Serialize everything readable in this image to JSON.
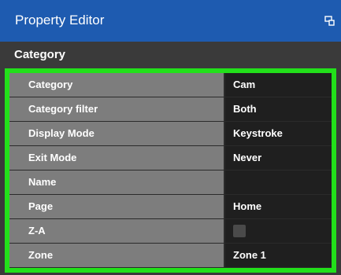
{
  "window": {
    "title": "Property Editor",
    "title_icon": "popout-window-icon"
  },
  "section": {
    "title": "Category"
  },
  "properties": [
    {
      "name": "Category",
      "value": "Cam"
    },
    {
      "name": "Category filter",
      "value": "Both"
    },
    {
      "name": "Display Mode",
      "value": "Keystroke"
    },
    {
      "name": "Exit Mode",
      "value": "Never"
    },
    {
      "name": "Name",
      "value": ""
    },
    {
      "name": "Page",
      "value": "Home"
    },
    {
      "name": "Z-A",
      "value": "",
      "checked": false
    },
    {
      "name": "Zone",
      "value": "Zone 1"
    }
  ],
  "colors": {
    "titlebar": "#1e5bb0",
    "highlight": "#22e01a",
    "name_cell": "#7d7d7d",
    "value_cell": "#1f1f1f",
    "background": "#3a3a3a"
  }
}
